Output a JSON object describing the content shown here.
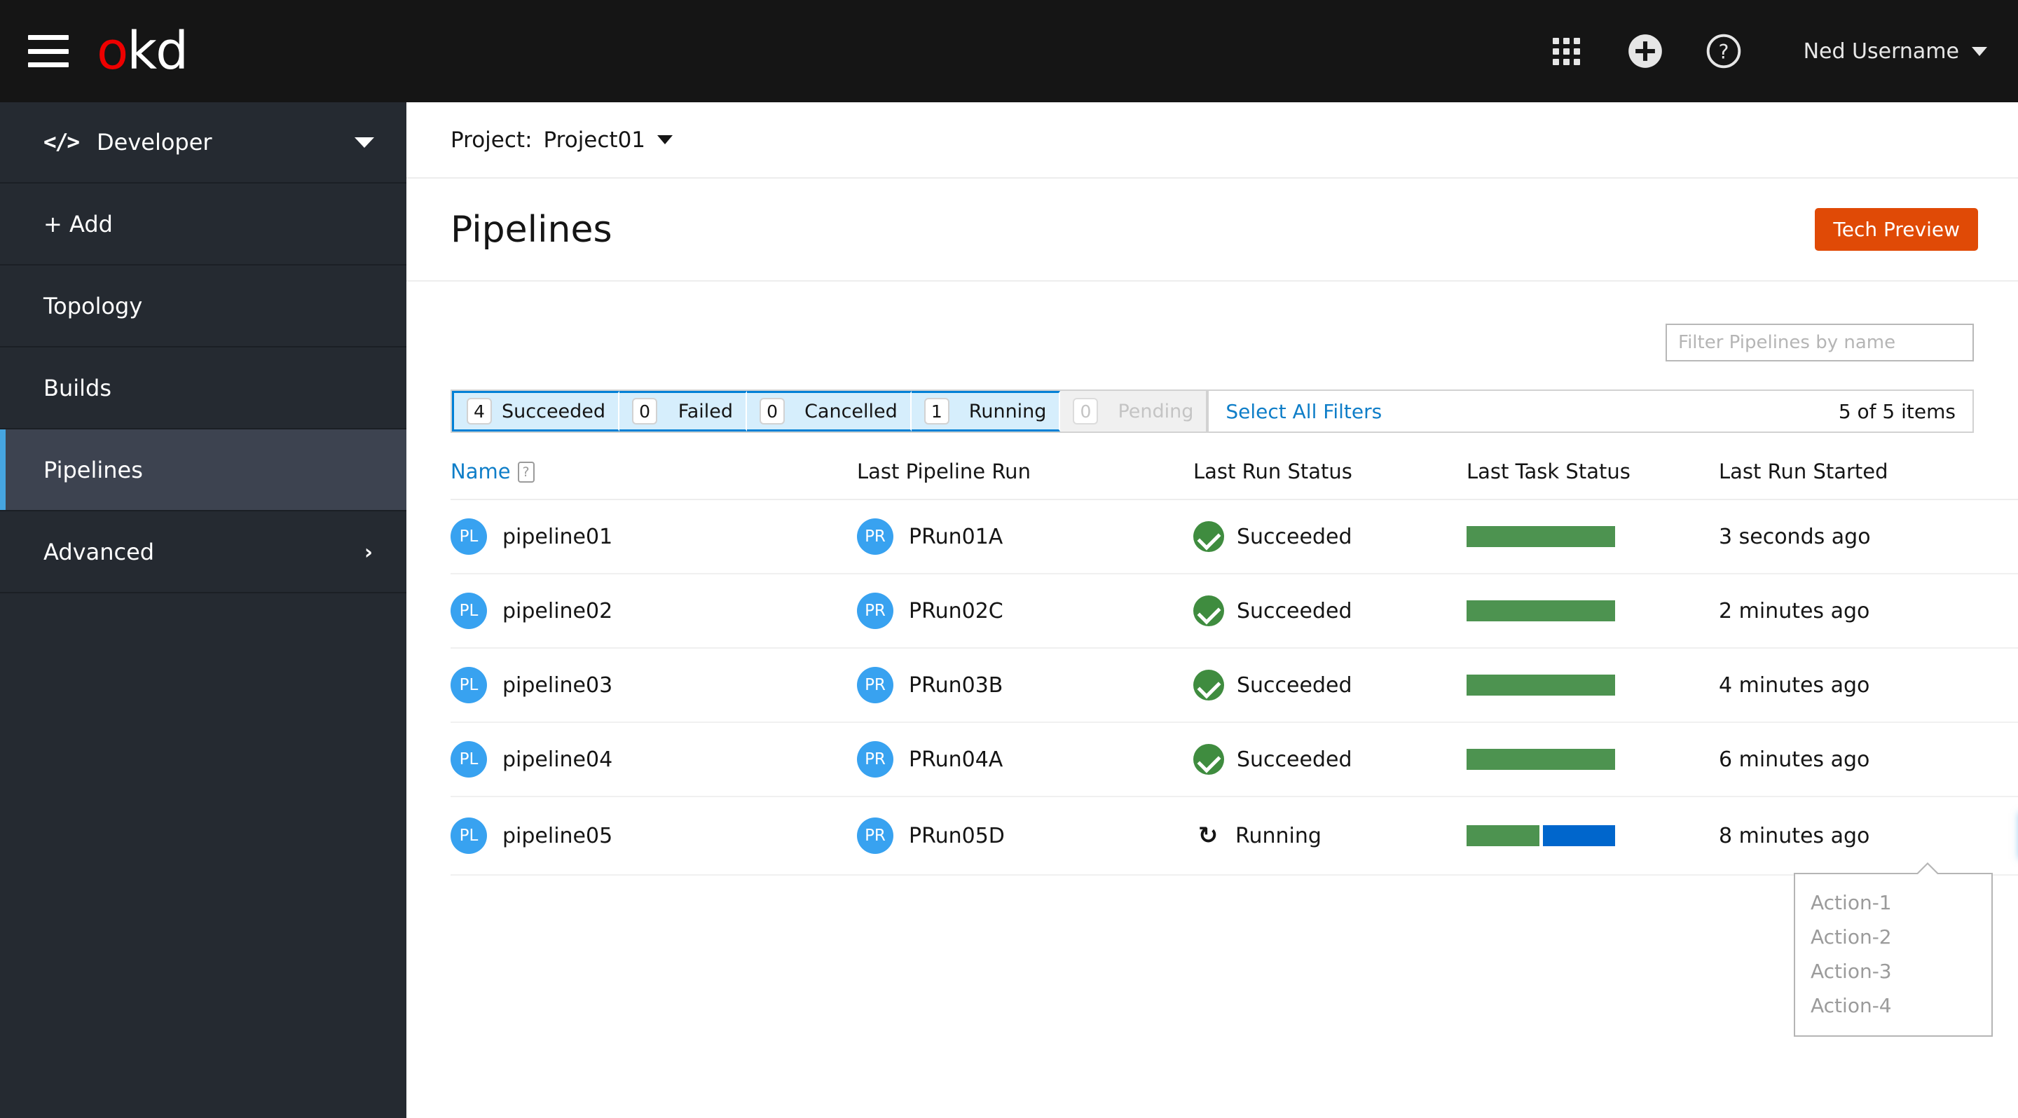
{
  "masthead": {
    "brand_o": "o",
    "brand_kd": "kd",
    "icons": {
      "menu": "hamburger-icon",
      "apps": "grid-apps-icon",
      "add": "plus-circle-icon",
      "help": "question-circle-icon"
    },
    "username": "Ned Username"
  },
  "sidebar": {
    "perspective": {
      "label": "Developer",
      "icon": "code-icon"
    },
    "items": [
      {
        "label": "+ Add",
        "active": false
      },
      {
        "label": "Topology",
        "active": false
      },
      {
        "label": "Builds",
        "active": false
      },
      {
        "label": "Pipelines",
        "active": true
      },
      {
        "label": "Advanced",
        "active": false,
        "chevron": "›"
      }
    ]
  },
  "project_bar": {
    "label": "Project:",
    "value": "Project01"
  },
  "page": {
    "title": "Pipelines",
    "tech_preview_badge": "Tech Preview"
  },
  "toolbar": {
    "filter_placeholder": "Filter Pipelines by name",
    "filter_value": "",
    "select_all_filters": "Select All Filters",
    "items_count": "5 of 5 items",
    "status_filters": [
      {
        "count": "4",
        "label": "Succeeded",
        "state": "active"
      },
      {
        "count": "0",
        "label": "Failed",
        "state": "active"
      },
      {
        "count": "0",
        "label": "Cancelled",
        "state": "active"
      },
      {
        "count": "1",
        "label": "Running",
        "state": "active"
      },
      {
        "count": "0",
        "label": "Pending",
        "state": "disabled"
      }
    ]
  },
  "table": {
    "headers": {
      "name": "Name",
      "name_help": "?",
      "last_pipeline_run": "Last Pipeline Run",
      "last_run_status": "Last Run Status",
      "last_task_status": "Last Task Status",
      "last_run_started": "Last Run Started"
    },
    "rows": [
      {
        "badge_pl": "PL",
        "name": "pipeline01",
        "badge_pr": "PR",
        "run": "PRun01A",
        "status": "Succeeded",
        "status_icon": "check-circle-icon",
        "task_green_pct": 100,
        "task_blue_pct": 0,
        "started": "3 seconds ago",
        "kebab_focused": false
      },
      {
        "badge_pl": "PL",
        "name": "pipeline02",
        "badge_pr": "PR",
        "run": "PRun02C",
        "status": "Succeeded",
        "status_icon": "check-circle-icon",
        "task_green_pct": 100,
        "task_blue_pct": 0,
        "started": "2 minutes ago",
        "kebab_focused": false
      },
      {
        "badge_pl": "PL",
        "name": "pipeline03",
        "badge_pr": "PR",
        "run": "PRun03B",
        "status": "Succeeded",
        "status_icon": "check-circle-icon",
        "task_green_pct": 100,
        "task_blue_pct": 0,
        "started": "4 minutes ago",
        "kebab_focused": false
      },
      {
        "badge_pl": "PL",
        "name": "pipeline04",
        "badge_pr": "PR",
        "run": "PRun04A",
        "status": "Succeeded",
        "status_icon": "check-circle-icon",
        "task_green_pct": 100,
        "task_blue_pct": 0,
        "started": "6 minutes ago",
        "kebab_focused": false
      },
      {
        "badge_pl": "PL",
        "name": "pipeline05",
        "badge_pr": "PR",
        "run": "PRun05D",
        "status": "Running",
        "status_icon": "sync-icon",
        "task_green_pct": 50,
        "task_blue_pct": 50,
        "started": "8 minutes ago",
        "kebab_focused": true
      }
    ]
  },
  "dropdown": {
    "open": true,
    "items": [
      "Action-1",
      "Action-2",
      "Action-3",
      "Action-4"
    ]
  },
  "colors": {
    "brand_red": "#ee0000",
    "masthead_bg": "#151515",
    "sidebar_bg": "#252a31",
    "sidebar_active_bg": "#3d4350",
    "accent_blue": "#0f7ec8",
    "active_indicator": "#46a5e0",
    "tech_preview_bg": "#e04a06",
    "success_green": "#3f8c3f",
    "task_green": "#4d9350",
    "task_blue": "#0066cc",
    "badge_blue": "#38a2f0",
    "chip_active_bg": "#d6eefc",
    "chip_border_blue": "#0080d6"
  }
}
